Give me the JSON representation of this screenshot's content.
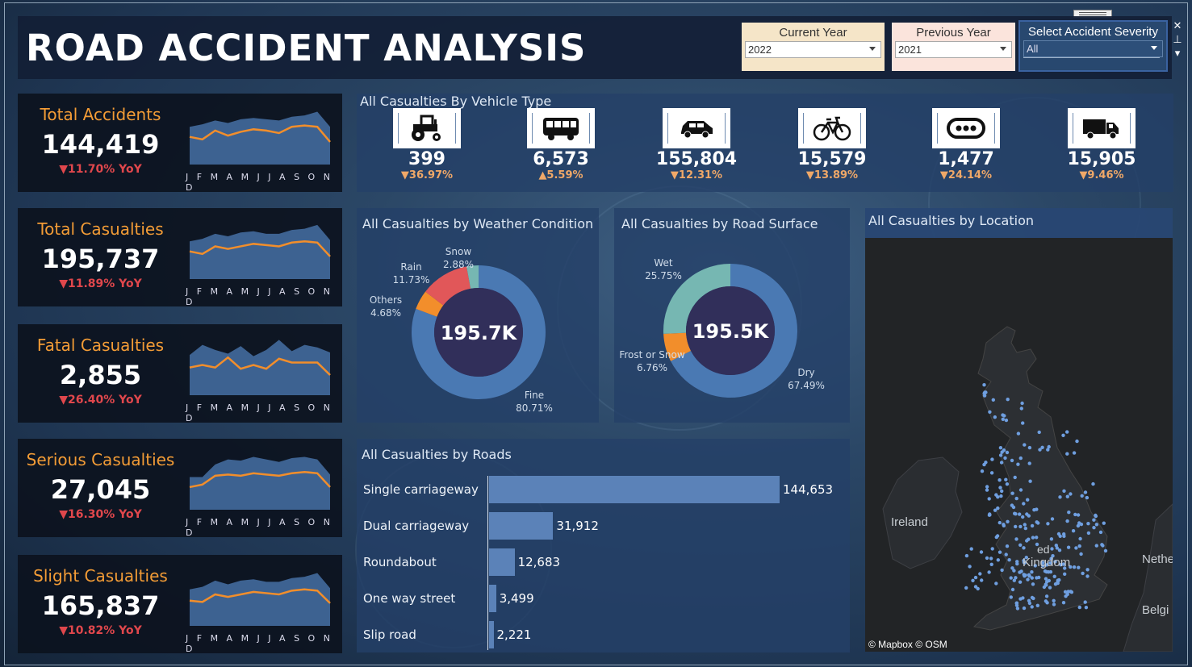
{
  "title": "ROAD ACCIDENT ANALYSIS",
  "filters": {
    "current_year": {
      "label": "Current Year",
      "value": "2022"
    },
    "previous_year": {
      "label": "Previous Year",
      "value": "2021"
    },
    "severity": {
      "label": "Select Accident Severity",
      "value": "All"
    }
  },
  "window_controls": {
    "close": "✕",
    "pin": "⊥",
    "more": "▾"
  },
  "months_text": "J F M A M J J A S O N D",
  "kpis": [
    {
      "label": "Total Accidents",
      "value": "144,419",
      "yoy": "▼11.70% YoY",
      "current": [
        62,
        60,
        67,
        63,
        66,
        68,
        67,
        65,
        70,
        71,
        70,
        58
      ],
      "previous": [
        70,
        72,
        75,
        73,
        76,
        77,
        76,
        75,
        78,
        79,
        82,
        70
      ]
    },
    {
      "label": "Total Casualties",
      "value": "195,737",
      "yoy": "▼11.89% YoY",
      "current": [
        62,
        60,
        66,
        64,
        66,
        68,
        67,
        66,
        69,
        70,
        69,
        58
      ],
      "previous": [
        70,
        72,
        76,
        74,
        77,
        78,
        76,
        76,
        79,
        80,
        83,
        71
      ]
    },
    {
      "label": "Fatal Casualties",
      "value": "2,855",
      "yoy": "▼26.40% YoY",
      "current": [
        62,
        64,
        62,
        70,
        61,
        64,
        61,
        69,
        66,
        66,
        66,
        56
      ],
      "previous": [
        72,
        80,
        76,
        73,
        79,
        71,
        76,
        84,
        75,
        80,
        78,
        74
      ]
    },
    {
      "label": "Serious Casualties",
      "value": "27,045",
      "yoy": "▼16.30% YoY",
      "current": [
        58,
        60,
        67,
        68,
        67,
        69,
        68,
        67,
        69,
        70,
        69,
        58
      ],
      "previous": [
        66,
        66,
        76,
        80,
        79,
        82,
        80,
        78,
        81,
        82,
        80,
        68
      ]
    },
    {
      "label": "Slight Casualties",
      "value": "165,837",
      "yoy": "▼10.82% YoY",
      "current": [
        60,
        59,
        65,
        63,
        65,
        67,
        66,
        65,
        68,
        69,
        68,
        58
      ],
      "previous": [
        69,
        71,
        76,
        73,
        76,
        77,
        75,
        75,
        78,
        79,
        82,
        70
      ]
    }
  ],
  "vehicle_panel": {
    "title": "All Casualties By Vehicle Type",
    "items": [
      {
        "icon": "tractor-icon",
        "value": "399",
        "change": "▼36.97%"
      },
      {
        "icon": "bus-icon",
        "value": "6,573",
        "change": "▲5.59%"
      },
      {
        "icon": "car-icon",
        "value": "155,804",
        "change": "▼12.31%"
      },
      {
        "icon": "bicycle-icon",
        "value": "15,579",
        "change": "▼13.89%"
      },
      {
        "icon": "other-vehicle-icon",
        "value": "1,477",
        "change": "▼24.14%"
      },
      {
        "icon": "van-icon",
        "value": "15,905",
        "change": "▼9.46%"
      }
    ]
  },
  "weather_chart": {
    "title": "All Casualties by Weather Condition",
    "center": "195.7K",
    "slices": [
      {
        "name": "Fine",
        "pct": "80.71%",
        "value": 80.71,
        "color": "#4a79b3"
      },
      {
        "name": "Others",
        "pct": "4.68%",
        "value": 4.68,
        "color": "#f28e2b"
      },
      {
        "name": "Rain",
        "pct": "11.73%",
        "value": 11.73,
        "color": "#e15759"
      },
      {
        "name": "Snow",
        "pct": "2.88%",
        "value": 2.88,
        "color": "#76b7b2"
      }
    ]
  },
  "surface_chart": {
    "title": "All Casualties by Road Surface",
    "center": "195.5K",
    "slices": [
      {
        "name": "Dry",
        "pct": "67.49%",
        "value": 67.49,
        "color": "#4a79b3"
      },
      {
        "name": "Frost or Snow",
        "pct": "6.76%",
        "value": 6.76,
        "color": "#f28e2b"
      },
      {
        "name": "Wet",
        "pct": "25.75%",
        "value": 25.75,
        "color": "#76b7b2"
      }
    ]
  },
  "roads_chart": {
    "title": "All Casualties by Roads",
    "rows": [
      {
        "label": "Single carriageway",
        "value": 144653,
        "text": "144,653"
      },
      {
        "label": "Dual carriageway",
        "value": 31912,
        "text": "31,912"
      },
      {
        "label": "Roundabout",
        "value": 12683,
        "text": "12,683"
      },
      {
        "label": "One way street",
        "value": 3499,
        "text": "3,499"
      },
      {
        "label": "Slip road",
        "value": 2221,
        "text": "2,221"
      }
    ]
  },
  "map_panel": {
    "title": "All Casualties by Location",
    "labels": {
      "ireland": "Ireland",
      "kingdom": "Kingdom",
      "netherlands": "Nethe",
      "belgium": "Belgi",
      "united": "ed"
    },
    "attribution": "© Mapbox © OSM"
  },
  "chart_data": [
    {
      "type": "donut",
      "title": "All Casualties by Weather Condition",
      "total_label": "195.7K",
      "categories": [
        "Fine",
        "Others",
        "Rain",
        "Snow"
      ],
      "values": [
        80.71,
        4.68,
        11.73,
        2.88
      ]
    },
    {
      "type": "donut",
      "title": "All Casualties by Road Surface",
      "total_label": "195.5K",
      "categories": [
        "Dry",
        "Frost or Snow",
        "Wet"
      ],
      "values": [
        67.49,
        6.76,
        25.75
      ]
    },
    {
      "type": "bar",
      "title": "All Casualties by Roads",
      "categories": [
        "Single carriageway",
        "Dual carriageway",
        "Roundabout",
        "One way street",
        "Slip road"
      ],
      "values": [
        144653,
        31912,
        12683,
        3499,
        2221
      ]
    }
  ]
}
